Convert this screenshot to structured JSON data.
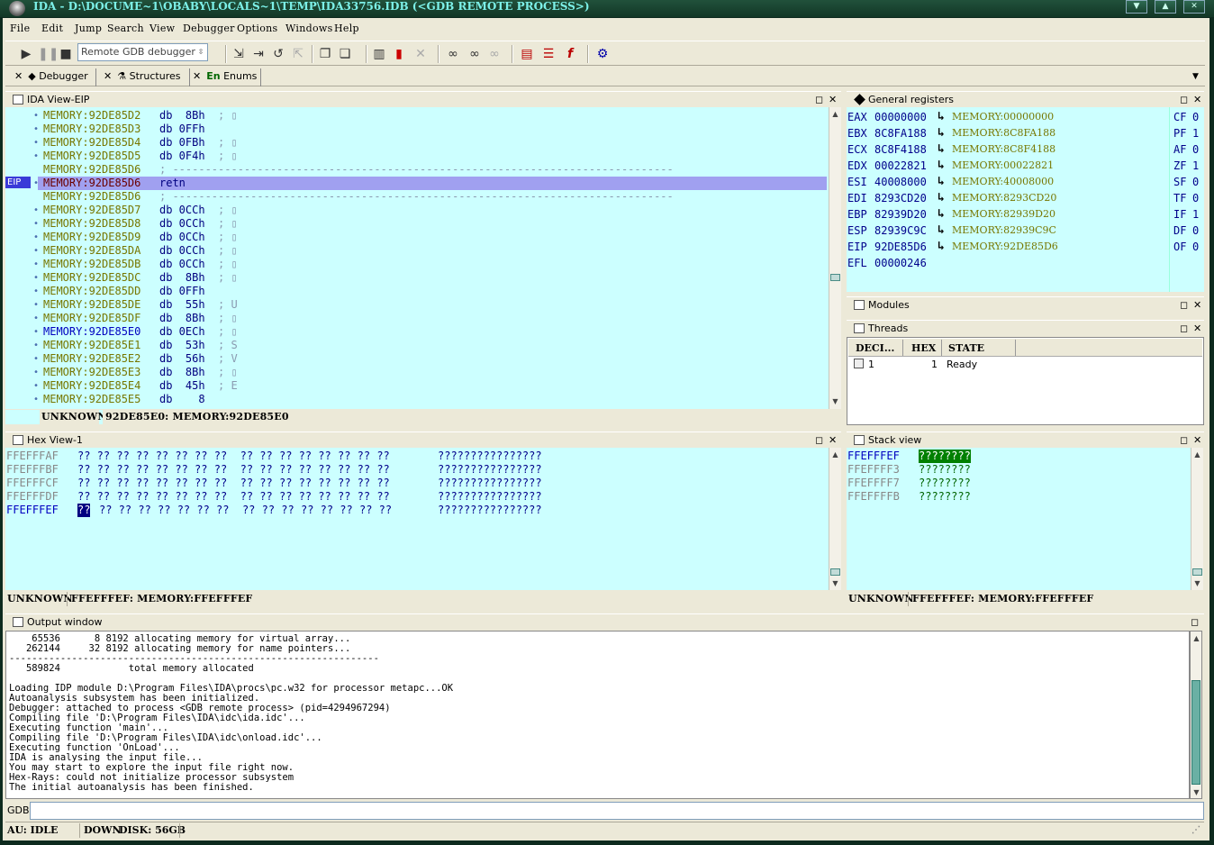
{
  "window": {
    "title": "IDA - D:\\DOCUME~1\\OBABY\\LOCALS~1\\TEMP\\IDA33756.IDB (<GDB REMOTE PROCESS>)"
  },
  "menu": [
    "File",
    "Edit",
    "Jump",
    "Search",
    "View",
    "Debugger",
    "Options",
    "Windows",
    "Help"
  ],
  "toolbar": {
    "debugger_select": "Remote GDB debugger"
  },
  "tabs": [
    {
      "label": "Debugger"
    },
    {
      "label": "Structures"
    },
    {
      "prefix": "En",
      "label": "Enums"
    }
  ],
  "ida_view": {
    "title": "IDA View-EIP",
    "eip_label": "EIP",
    "rows": [
      {
        "addr": "MEMORY:92DE85D2",
        "ins": "db  8Bh",
        "cmt": "; ▯",
        "dot": true
      },
      {
        "addr": "MEMORY:92DE85D3",
        "ins": "db 0FFh",
        "cmt": "",
        "dot": true
      },
      {
        "addr": "MEMORY:92DE85D4",
        "ins": "db 0FBh",
        "cmt": "; ▯",
        "dot": true
      },
      {
        "addr": "MEMORY:92DE85D5",
        "ins": "db 0F4h",
        "cmt": "; ▯",
        "dot": true
      },
      {
        "addr": "MEMORY:92DE85D6",
        "ins": "",
        "cmt": "; -----------------------------------------------------------------------------",
        "dot": false,
        "sep": true
      },
      {
        "addr": "MEMORY:92DE85D6",
        "ins": "retn",
        "cmt": "",
        "dot": true,
        "highlight": true
      },
      {
        "addr": "MEMORY:92DE85D6",
        "ins": "",
        "cmt": "; -----------------------------------------------------------------------------",
        "dot": false,
        "sep": true
      },
      {
        "addr": "MEMORY:92DE85D7",
        "ins": "db 0CCh",
        "cmt": "; ▯",
        "dot": true
      },
      {
        "addr": "MEMORY:92DE85D8",
        "ins": "db 0CCh",
        "cmt": "; ▯",
        "dot": true
      },
      {
        "addr": "MEMORY:92DE85D9",
        "ins": "db 0CCh",
        "cmt": "; ▯",
        "dot": true
      },
      {
        "addr": "MEMORY:92DE85DA",
        "ins": "db 0CCh",
        "cmt": "; ▯",
        "dot": true
      },
      {
        "addr": "MEMORY:92DE85DB",
        "ins": "db 0CCh",
        "cmt": "; ▯",
        "dot": true
      },
      {
        "addr": "MEMORY:92DE85DC",
        "ins": "db  8Bh",
        "cmt": "; ▯",
        "dot": true
      },
      {
        "addr": "MEMORY:92DE85DD",
        "ins": "db 0FFh",
        "cmt": "",
        "dot": true
      },
      {
        "addr": "MEMORY:92DE85DE",
        "ins": "db  55h",
        "cmt": "; U",
        "dot": true
      },
      {
        "addr": "MEMORY:92DE85DF",
        "ins": "db  8Bh",
        "cmt": "; ▯",
        "dot": true
      },
      {
        "addr": "MEMORY:92DE85E0",
        "ins": "db 0ECh",
        "cmt": "; ▯",
        "dot": true,
        "blue": true
      },
      {
        "addr": "MEMORY:92DE85E1",
        "ins": "db  53h",
        "cmt": "; S",
        "dot": true
      },
      {
        "addr": "MEMORY:92DE85E2",
        "ins": "db  56h",
        "cmt": "; V",
        "dot": true
      },
      {
        "addr": "MEMORY:92DE85E3",
        "ins": "db  8Bh",
        "cmt": "; ▯",
        "dot": true
      },
      {
        "addr": "MEMORY:92DE85E4",
        "ins": "db  45h",
        "cmt": "; E",
        "dot": true
      },
      {
        "addr": "MEMORY:92DE85E5",
        "ins": "db    8",
        "cmt": "",
        "dot": true
      }
    ],
    "status_left": "UNKNOWN",
    "status_right": "92DE85E0: MEMORY:92DE85E0"
  },
  "registers": {
    "title": "General registers",
    "rows": [
      {
        "name": "EAX",
        "value": "00000000",
        "ref": "MEMORY:00000000",
        "flag": "CF",
        "fv": "0"
      },
      {
        "name": "EBX",
        "value": "8C8FA188",
        "ref": "MEMORY:8C8FA188",
        "flag": "PF",
        "fv": "1"
      },
      {
        "name": "ECX",
        "value": "8C8F4188",
        "ref": "MEMORY:8C8F4188",
        "flag": "AF",
        "fv": "0"
      },
      {
        "name": "EDX",
        "value": "00022821",
        "ref": "MEMORY:00022821",
        "flag": "ZF",
        "fv": "1"
      },
      {
        "name": "ESI",
        "value": "40008000",
        "ref": "MEMORY:40008000",
        "flag": "SF",
        "fv": "0"
      },
      {
        "name": "EDI",
        "value": "8293CD20",
        "ref": "MEMORY:8293CD20",
        "flag": "TF",
        "fv": "0"
      },
      {
        "name": "EBP",
        "value": "82939D20",
        "ref": "MEMORY:82939D20",
        "flag": "IF",
        "fv": "1"
      },
      {
        "name": "ESP",
        "value": "82939C9C",
        "ref": "MEMORY:82939C9C",
        "flag": "DF",
        "fv": "0"
      },
      {
        "name": "EIP",
        "value": "92DE85D6",
        "ref": "MEMORY:92DE85D6",
        "flag": "OF",
        "fv": "0"
      },
      {
        "name": "EFL",
        "value": "00000246",
        "ref": "",
        "flag": "",
        "fv": ""
      }
    ]
  },
  "modules": {
    "title": "Modules"
  },
  "threads": {
    "title": "Threads",
    "columns": [
      "DECI...",
      "HEX",
      "STATE"
    ],
    "rows": [
      {
        "deci": "1",
        "hex": "1",
        "state": "Ready"
      }
    ]
  },
  "hex_view": {
    "title": "Hex View-1",
    "rows": [
      {
        "addr": "FFEFFFAF",
        "bytes": "?? ?? ?? ?? ?? ?? ?? ??  ?? ?? ?? ?? ?? ?? ?? ??",
        "ascii": "????????????????"
      },
      {
        "addr": "FFEFFFBF",
        "bytes": "?? ?? ?? ?? ?? ?? ?? ??  ?? ?? ?? ?? ?? ?? ?? ??",
        "ascii": "????????????????"
      },
      {
        "addr": "FFEFFFCF",
        "bytes": "?? ?? ?? ?? ?? ?? ?? ??  ?? ?? ?? ?? ?? ?? ?? ??",
        "ascii": "????????????????"
      },
      {
        "addr": "FFEFFFDF",
        "bytes": "?? ?? ?? ?? ?? ?? ?? ??  ?? ?? ?? ?? ?? ?? ?? ??",
        "ascii": "????????????????"
      },
      {
        "addr": "FFEFFFEF",
        "first": "??",
        "bytes": "?? ?? ?? ?? ?? ?? ??  ?? ?? ?? ?? ?? ?? ?? ??",
        "ascii": "????????????????",
        "current": true
      }
    ],
    "status_left": "UNKNOWN",
    "status_right": "FFEFFFEF: MEMORY:FFEFFFEF"
  },
  "stack_view": {
    "title": "Stack view",
    "rows": [
      {
        "addr": "FFEFFFEF",
        "value": "????????",
        "current": true
      },
      {
        "addr": "FFEFFFF3",
        "value": "????????"
      },
      {
        "addr": "FFEFFFF7",
        "value": "????????"
      },
      {
        "addr": "FFEFFFFB",
        "value": "????????"
      }
    ],
    "status_left": "UNKNOWN",
    "status_right": "FFEFFFEF: MEMORY:FFEFFFEF"
  },
  "output": {
    "title": "Output window",
    "lines": [
      "    65536      8 8192 allocating memory for virtual array...",
      "   262144     32 8192 allocating memory for name pointers...",
      "-----------------------------------------------------------------",
      "   589824            total memory allocated",
      "",
      "Loading IDP module D:\\Program Files\\IDA\\procs\\pc.w32 for processor metapc...OK",
      "Autoanalysis subsystem has been initialized.",
      "Debugger: attached to process <GDB remote process> (pid=4294967294)",
      "Compiling file 'D:\\Program Files\\IDA\\idc\\ida.idc'...",
      "Executing function 'main'...",
      "Compiling file 'D:\\Program Files\\IDA\\idc\\onload.idc'...",
      "Executing function 'OnLoad'...",
      "IDA is analysing the input file...",
      "You may start to explore the input file right now.",
      "Hex-Rays: could not initialize processor subsystem",
      "The initial autoanalysis has been finished."
    ],
    "cmd_label": "GDB",
    "cmd_value": ""
  },
  "statusbar": {
    "au": "AU:  IDLE",
    "down": "DOWN",
    "disk": "DISK: 56GB"
  },
  "colors": {
    "pane_bg": "#ccffff",
    "highlight": "#a0a0f0",
    "address": "#777700",
    "instr": "#000080",
    "eip_bg": "#3a3ad8",
    "stack_sel": "#008000"
  }
}
